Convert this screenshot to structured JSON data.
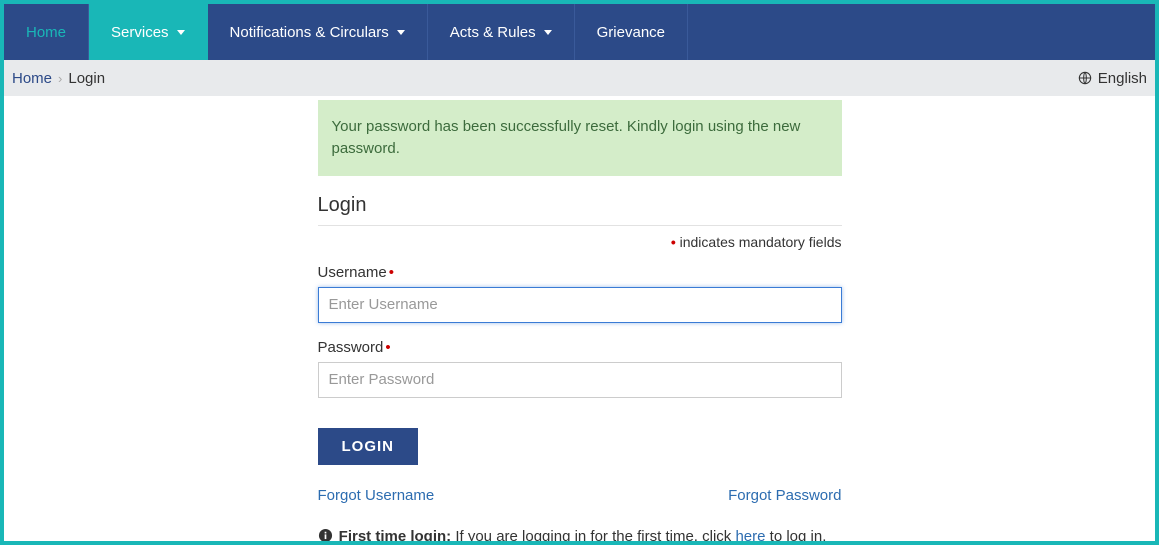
{
  "nav": {
    "home": "Home",
    "services": "Services",
    "notifications": "Notifications & Circulars",
    "acts": "Acts & Rules",
    "grievance": "Grievance"
  },
  "breadcrumb": {
    "home": "Home",
    "current": "Login"
  },
  "language": "English",
  "alert": "Your password has been successfully reset. Kindly login using the new password.",
  "page_title": "Login",
  "mandatory_note": "indicates mandatory fields",
  "form": {
    "username_label": "Username",
    "username_placeholder": "Enter Username",
    "password_label": "Password",
    "password_placeholder": "Enter Password",
    "login_button": "LOGIN"
  },
  "links": {
    "forgot_username": "Forgot Username",
    "forgot_password": "Forgot Password"
  },
  "first_time": {
    "label": "First time login:",
    "text_before": " If you are logging in for the first time, click ",
    "here": "here",
    "text_after": " to log in."
  }
}
